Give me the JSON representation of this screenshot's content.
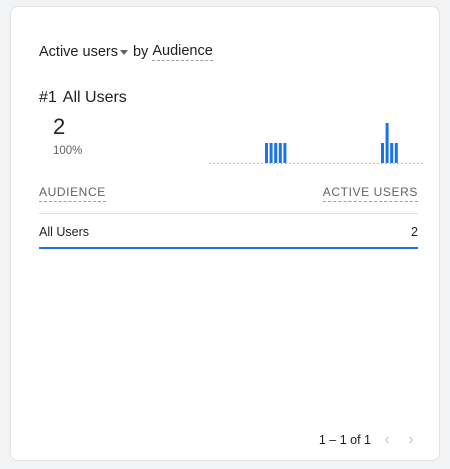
{
  "card": {
    "metric": "Active users",
    "by_text": "by",
    "dimension": "Audience"
  },
  "top_item": {
    "rank": "#1",
    "name": "All Users",
    "value": "2",
    "percent": "100%"
  },
  "sparkline": {
    "type": "bar",
    "color": "#1a73e8",
    "baseline_color": "#c9c9c9",
    "bars": [
      {
        "group": 1,
        "value": 1
      },
      {
        "group": 1,
        "value": 1
      },
      {
        "group": 1,
        "value": 1
      },
      {
        "group": 1,
        "value": 1
      },
      {
        "group": 1,
        "value": 1
      },
      {
        "group": 2,
        "value": 1
      },
      {
        "group": 2,
        "value": 2
      },
      {
        "group": 2,
        "value": 1
      },
      {
        "group": 2,
        "value": 1
      }
    ]
  },
  "table": {
    "columns": [
      "AUDIENCE",
      "ACTIVE USERS"
    ],
    "rows": [
      {
        "audience": "All Users",
        "active_users": "2"
      }
    ]
  },
  "pagination": {
    "range": "1 – 1 of 1",
    "prev_icon": "chevron-left-icon",
    "next_icon": "chevron-right-icon"
  },
  "colors": {
    "accent": "#1a73e8",
    "muted_text": "#5f6368"
  }
}
